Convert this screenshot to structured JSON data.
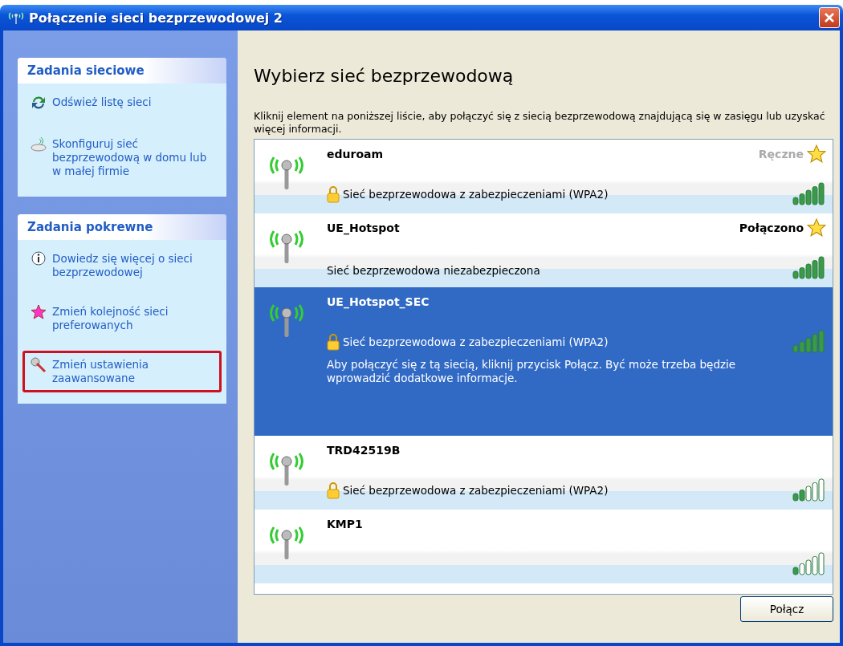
{
  "window": {
    "title": "Połączenie sieci bezprzewodowej 2"
  },
  "task_panels": [
    {
      "title": "Zadania sieciowe",
      "items": [
        {
          "label": "Odśwież listę sieci",
          "highlighted": false
        },
        {
          "label": "Skonfiguruj sieć bezprzewodową w domu lub w małej firmie",
          "highlighted": false
        }
      ]
    },
    {
      "title": "Zadania pokrewne",
      "items": [
        {
          "label": "Dowiedz się więcej o sieci bezprzewodowej",
          "highlighted": false
        },
        {
          "label": "Zmień kolejność sieci preferowanych",
          "highlighted": false
        },
        {
          "label": "Zmień ustawienia zaawansowane",
          "highlighted": true
        }
      ]
    }
  ],
  "heading": "Wybierz sieć bezprzewodową",
  "intro": "Kliknij element na poniższej liście, aby połączyć się z siecią bezprzewodową znajdującą się w zasięgu lub uzyskać więcej informacji.",
  "networks": [
    {
      "name": "eduroam",
      "status": "Ręczne",
      "connected": false,
      "preferred": true,
      "secured": true,
      "security": "Sieć bezprzewodowa z zabezpieczeniami (WPA2)",
      "level": 1.0,
      "selected": false
    },
    {
      "name": "UE_Hotspot",
      "status": "Połączono",
      "connected": true,
      "preferred": true,
      "secured": false,
      "security": "Sieć bezprzewodowa niezabezpieczona",
      "level": 1.0,
      "selected": false
    },
    {
      "name": "UE_Hotspot_SEC",
      "preferred": false,
      "secured": true,
      "security": "Sieć bezprzewodowa z zabezpieczeniami (WPA2)",
      "description": "Aby połączyć się z tą siecią, kliknij przycisk Połącz. Być może trzeba będzie wprowadzić dodatkowe informacje.",
      "level": 1.0,
      "selected": true
    },
    {
      "name": "TRD42519B",
      "preferred": false,
      "secured": true,
      "security": "Sieć bezprzewodowa z zabezpieczeniami (WPA2)",
      "level": 0.4,
      "selected": false
    },
    {
      "name": "KMP1",
      "level": 0.2,
      "selected": false
    }
  ],
  "connect_button": "Połącz"
}
